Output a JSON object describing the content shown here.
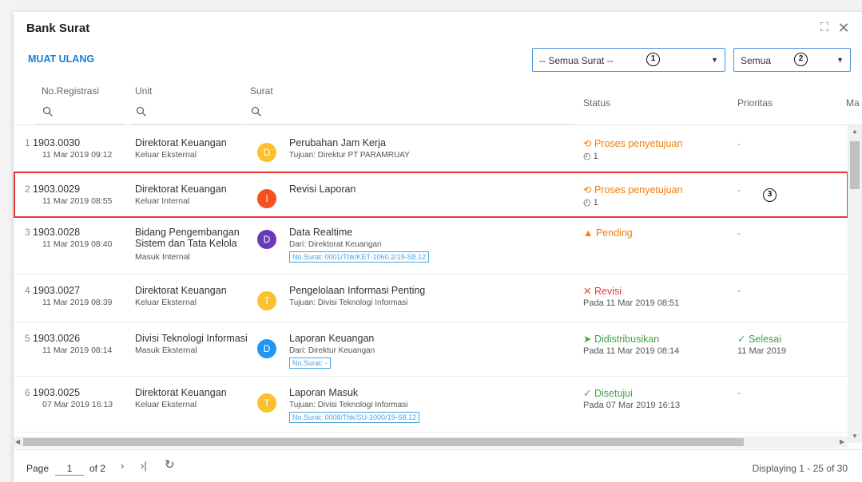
{
  "window": {
    "title": "Bank Surat",
    "expand_icon": "⛶",
    "close_icon": "✕"
  },
  "toolbar": {
    "reload_label": "MUAT ULANG",
    "filter_surat": {
      "value": "-- Semua Surat --",
      "badge": "1"
    },
    "filter_status": {
      "value": "Semua",
      "badge": "2"
    }
  },
  "columns": {
    "registrasi": "No.Registrasi",
    "unit": "Unit",
    "surat": "Surat",
    "status": "Status",
    "prioritas": "Prioritas",
    "more": "Ma"
  },
  "highlight_badge": "3",
  "rows": [
    {
      "num": "1",
      "reg_no": "1903.0030",
      "reg_date": "11 Mar 2019 09:12",
      "unit": "Direktorat Keuangan",
      "unit_sub": "Keluar Eksternal",
      "avatar": "D",
      "avatar_color": "#FBC02D",
      "subject": "Perubahan Jam Kerja",
      "subject_sub": "Tujuan: Direktur PT PARAMRUAY",
      "no_surat": "",
      "status": "Proses penyetujuan",
      "status_icon": "clock-refresh-icon",
      "status_color": "#F57C00",
      "status_sub": "◴ 1",
      "prio": "-",
      "prio_sub": ""
    },
    {
      "num": "2",
      "reg_no": "1903.0029",
      "reg_date": "11 Mar 2019 08:55",
      "unit": "Direktorat Keuangan",
      "unit_sub": "Keluar Internal",
      "avatar": "I",
      "avatar_color": "#F4511E",
      "subject": "Revisi Laporan",
      "subject_sub": "",
      "no_surat": "",
      "status": "Proses penyetujuan",
      "status_icon": "clock-refresh-icon",
      "status_color": "#F57C00",
      "status_sub": "◴ 1",
      "prio": "-",
      "prio_sub": ""
    },
    {
      "num": "3",
      "reg_no": "1903.0028",
      "reg_date": "11 Mar 2019 08:40",
      "unit": "Bidang Pengembangan Sistem dan Tata Kelola",
      "unit_sub": "Masuk Internal",
      "avatar": "D",
      "avatar_color": "#673AB7",
      "subject": "Data Realtime",
      "subject_sub": "Dari: Direktorat Keuangan",
      "no_surat": "No.Surat: 0001/Tbk/KET-1060.2/19-S8.12",
      "status": "Pending",
      "status_icon": "warning-icon",
      "status_color": "#F57C00",
      "status_sub": "",
      "prio": "-",
      "prio_sub": ""
    },
    {
      "num": "4",
      "reg_no": "1903.0027",
      "reg_date": "11 Mar 2019 08:39",
      "unit": "Direktorat Keuangan",
      "unit_sub": "Keluar Eksternal",
      "avatar": "T",
      "avatar_color": "#FBC02D",
      "subject": "Pengelolaan Informasi Penting",
      "subject_sub": "Tujuan: Divisi Teknologi Informasi",
      "no_surat": "",
      "status": "Revisi",
      "status_icon": "cross-icon",
      "status_color": "#E53935",
      "status_sub": "Pada 11 Mar 2019 08:51",
      "prio": "-",
      "prio_sub": ""
    },
    {
      "num": "5",
      "reg_no": "1903.0026",
      "reg_date": "11 Mar 2019 08:14",
      "unit": "Divisi Teknologi Informasi",
      "unit_sub": "Masuk Eksternal",
      "avatar": "D",
      "avatar_color": "#2196F3",
      "subject": "Laporan Keuangan",
      "subject_sub": "Dari: Direktur Keuangan",
      "no_surat": "No.Surat: -",
      "status": "Didistribusikan",
      "status_icon": "send-icon",
      "status_color": "#43A047",
      "status_sub": "Pada 11 Mar 2019 08:14",
      "prio": "Selesai",
      "prio_sub": "11 Mar 2019"
    },
    {
      "num": "6",
      "reg_no": "1903.0025",
      "reg_date": "07 Mar 2019 16:13",
      "unit": "Direktorat Keuangan",
      "unit_sub": "Keluar Eksternal",
      "avatar": "T",
      "avatar_color": "#FBC02D",
      "subject": "Laporan Masuk",
      "subject_sub": "Tujuan: Divisi Teknologi Informasi",
      "no_surat": "No.Surat: 0008/Tbk/SU-1000/19-S8.12",
      "status": "Disetujui",
      "status_icon": "check-icon",
      "status_color": "#43A047",
      "status_sub": "Pada 07 Mar 2019 16:13",
      "prio": "-",
      "prio_sub": ""
    }
  ],
  "pager": {
    "page_label": "Page",
    "page_value": "1",
    "of_label": "of 2",
    "next_icon": "›",
    "last_icon": "›|",
    "refresh_icon": "↻",
    "display_text": "Displaying 1 - 25 of 30"
  }
}
